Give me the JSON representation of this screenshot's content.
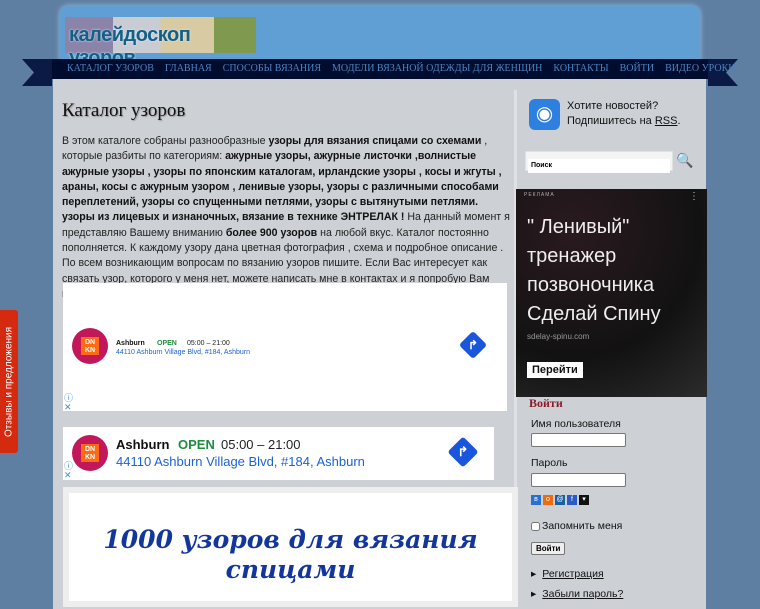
{
  "header": {
    "logo_text": "калейдоскоп узоров"
  },
  "nav": [
    "КАТАЛОГ УЗОРОВ",
    "ГЛАВНАЯ",
    "СПОСОБЫ ВЯЗАНИЯ",
    "МОДЕЛИ ВЯЗАНОЙ ОДЕЖДЫ ДЛЯ ЖЕНЩИН",
    "КОНТАКТЫ",
    "ВОЙТИ",
    "ВИДЕО УРОКИ"
  ],
  "main": {
    "title": "Каталог узоров",
    "intro": [
      {
        "t": "В этом каталоге собраны разнообразные ",
        "b": false
      },
      {
        "t": "узоры для вязания спицами со схемами",
        "b": true
      },
      {
        "t": " , которые разбиты по категориям: ",
        "b": false
      },
      {
        "t": "ажурные узоры, ажурные листочки ,волнистые ажурные узоры , узоры по японским каталогам, ирландские узоры , косы и жгуты , араны,  косы с ажурным узором , ленивые узоры, узоры с различными способами переплетений, узоры со спущенными петлями, узоры с вытянутыми  петлями. узоры из лицевых и изнаночных, вязание в технике ЭНТРЕЛАК !",
        "b": true
      },
      {
        "t": "  На данный момент я представляю Вашему вниманию ",
        "b": false
      },
      {
        "t": "более 900 узоров",
        "b": true
      },
      {
        "t": " на любой вкус.  Каталог постоянно пополняется. К каждому узору дана цветная фотография , схема и подробное описание . По всем возникающим вопросам по вязанию узоров пишите. Если Вас интересует как связать узор, которого у меня нет, можете написать мне в контактах и я попробую Вам помочь.",
        "b": false
      }
    ],
    "ad": {
      "logo": "DN KN",
      "city": "Ashburn",
      "status": "OPEN",
      "hours": "05:00 – 21:00",
      "address": "44110 Ashburn Village Blvd, #184, Ashburn"
    },
    "banner": "1000 узоров для вязания спицами"
  },
  "sidebar": {
    "rss_line1": "Хотите новостей?",
    "rss_line2": "Подпишитесь на ",
    "rss_link": "RSS",
    "rss_end": ".",
    "search_value": "Поиск",
    "ad": {
      "label": "РЕКЛАМА",
      "headline": "\" Ленивый\" тренажер позвоночника Сделай Спину",
      "url": "sdelay-spinu.com",
      "button": "Перейти"
    },
    "login": {
      "title": "Войти",
      "username_label": "Имя пользователя",
      "password_label": "Пароль",
      "remember": "Запомнить меня",
      "button": "Войти",
      "register": "Регистрация",
      "forgot": "Забыли пароль?"
    }
  },
  "feedback_tab": "Отзывы и предложения"
}
